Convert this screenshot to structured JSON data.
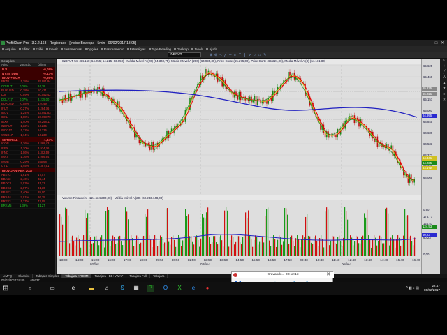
{
  "window": {
    "title": "ProfitChart Pro - 3.2.2.168 - Registrado - [Indice Bovespa - 5min - 06/02/2017 18:05]",
    "controls": [
      "–",
      "□",
      "✕"
    ]
  },
  "menu": [
    "Arquivo",
    "Editar",
    "Exibir",
    "Inserir",
    "Ferramentas",
    "Opções",
    "Rastreamento",
    "Estratégias",
    "Tape Reading",
    "Desktop",
    "Janela",
    "Ajuda"
  ],
  "toolbar": {
    "symbol": "INDFUT"
  },
  "watchlist": {
    "header": "Cotações",
    "columns": [
      "Ativo",
      "Variação",
      "Último"
    ],
    "groups": [
      {
        "name": "DJI",
        "change": "-0,09%",
        "rows": []
      },
      {
        "name": "NYSE DDR",
        "change": "-0,13%",
        "rows": []
      },
      {
        "name": "IBOV + EUA",
        "change": "-0,86%",
        "rows": [
          {
            "s": "BRZB",
            "c": "-1,28%",
            "p": "25.981,94",
            "up": false
          },
          {
            "s": "COIFUT",
            "c": "0,06%",
            "p": "24,38",
            "up": true
          },
          {
            "s": "EURUSD",
            "c": "-0,18%",
            "p": "10,431",
            "up": false
          },
          {
            "s": "DJI",
            "c": "-0,09%",
            "p": "20.052,42",
            "up": false
          },
          {
            "s": "DOLF17",
            "c": "0,07%",
            "p": "3.235,00",
            "up": true
          },
          {
            "s": "EURUSD",
            "c": "-0,08%",
            "p": "1,0749",
            "up": false
          },
          {
            "s": "IFUT",
            "c": "-0,27%",
            "p": "3.284,76",
            "up": false
          },
          {
            "s": "IBOV",
            "c": "-1,24%",
            "p": "63.991,83",
            "up": false
          },
          {
            "s": "IBXL",
            "c": "-1,08%",
            "p": "10.693,70",
            "up": false
          },
          {
            "s": "IBXX",
            "c": "-1,40%",
            "p": "28.298,11",
            "up": false
          },
          {
            "s": "INDFUT",
            "c": "-1,32%",
            "p": "64.235",
            "up": false
          },
          {
            "s": "INDG17",
            "c": "-1,32%",
            "p": "64.235",
            "up": false
          },
          {
            "s": "WING17",
            "c": "-1,74%",
            "p": "64.230",
            "up": false
          }
        ]
      },
      {
        "name": "SETORIAL",
        "change": "-1,34%",
        "rows": [
          {
            "s": "ICON",
            "c": "-1,76%",
            "p": "2.868,43",
            "up": false
          },
          {
            "s": "IEEX",
            "c": "-1,10%",
            "p": "3.974,76",
            "up": false
          },
          {
            "s": "IFNC",
            "c": "-1,06%",
            "p": "6.302,59",
            "up": false
          },
          {
            "s": "IMAT",
            "c": "-1,76%",
            "p": "1.986,94",
            "up": false
          },
          {
            "s": "IMOB",
            "c": "-0,29%",
            "p": "495,68",
            "up": false
          },
          {
            "s": "UTIL",
            "c": "-1,45%",
            "p": "2.387,91",
            "up": false
          }
        ]
      },
      {
        "name": "IBOV JAN-ABR 2017",
        "change": "",
        "rows": [
          {
            "s": "ABEV3",
            "c": "-1,61%",
            "p": "17,07",
            "up": false
          },
          {
            "s": "BBAS3",
            "c": "-2,46%",
            "p": "32,44",
            "up": false
          },
          {
            "s": "BBDC3",
            "c": "-2,03%",
            "p": "31,32",
            "up": false
          },
          {
            "s": "BBDC4",
            "c": "-2,07%",
            "p": "31,30",
            "up": false
          },
          {
            "s": "BBSE3",
            "c": "-1,40%",
            "p": "28,00",
            "up": false
          },
          {
            "s": "BRAP4",
            "c": "-3,01%",
            "p": "26,35",
            "up": false
          },
          {
            "s": "BRFS3",
            "c": "-1,77%",
            "p": "47,05",
            "up": false
          },
          {
            "s": "BRKM5",
            "c": "1,39%",
            "p": "31,27",
            "up": true
          }
        ]
      }
    ]
  },
  "chart": {
    "price_header": "INDFUT 5m (64.160; 64.255; 64.215; 63.650) · Média Móvel A (20) (64.340,75), Média Móvel A (200) (64.995,30), Price Corte (65.275,00), Price Corte (65.221,00), Média Móvel A (8) (64.171,80)",
    "volume_header": "Volume Financeiro (124.534.200,00) · Média Móvel A (20) (60.233.148,00)",
    "price_labels": [
      "65.625",
      "65.469",
      "65.313",
      "65.157",
      "65.001",
      "64.845",
      "64.689",
      "64.533",
      "64.377",
      "64.221",
      "64.065"
    ],
    "price_tags": [
      {
        "v": "65.275",
        "bg": "#888888"
      },
      {
        "v": "65.221",
        "bg": "#888888"
      },
      {
        "v": "64.995",
        "bg": "#2a2ad0"
      },
      {
        "v": "64.341",
        "bg": "#d0c020"
      },
      {
        "v": "64.235",
        "bg": "#1a8a1a"
      },
      {
        "v": "64.172",
        "bg": "#d0c020"
      }
    ],
    "volume_labels": [
      "0,90",
      "175,77",
      "124,53",
      "60,23",
      "0,00"
    ],
    "volume_tags": [
      {
        "v": "124,53",
        "bg": "#1a8a1a"
      },
      {
        "v": "60,23",
        "bg": "#2a2ad0"
      }
    ],
    "time_labels": [
      "13:00",
      "14:00",
      "15:00",
      "16:00",
      "17:00",
      "18:00",
      "09:50",
      "10:50",
      "11:50",
      "12:50",
      "13:50",
      "14:50",
      "15:50",
      "16:50",
      "17:50",
      "09:40",
      "10:40",
      "11:40",
      "12:40",
      "13:40",
      "14:40",
      "15:40",
      "16:40"
    ],
    "date_labels": [
      "02/fev",
      "03/fev",
      "06/fev"
    ]
  },
  "tabs": [
    "LIMFQ",
    "Clássico",
    "Tabajara Simples",
    "Tabajara +FRMM",
    "Tabajara +BB+VWAP",
    "Tabajara Full",
    "Tabajara"
  ],
  "active_tab": "Tabajara +FRMM",
  "statusbar": [
    "06/02/2017 18:05",
    "65.637",
    "ESFUT",
    "22:47:04",
    "Conectado"
  ],
  "recorder": {
    "title": "Gravando... 00:12:13"
  },
  "taskbar": {
    "time": "22:47",
    "date": "06/02/2017"
  }
}
